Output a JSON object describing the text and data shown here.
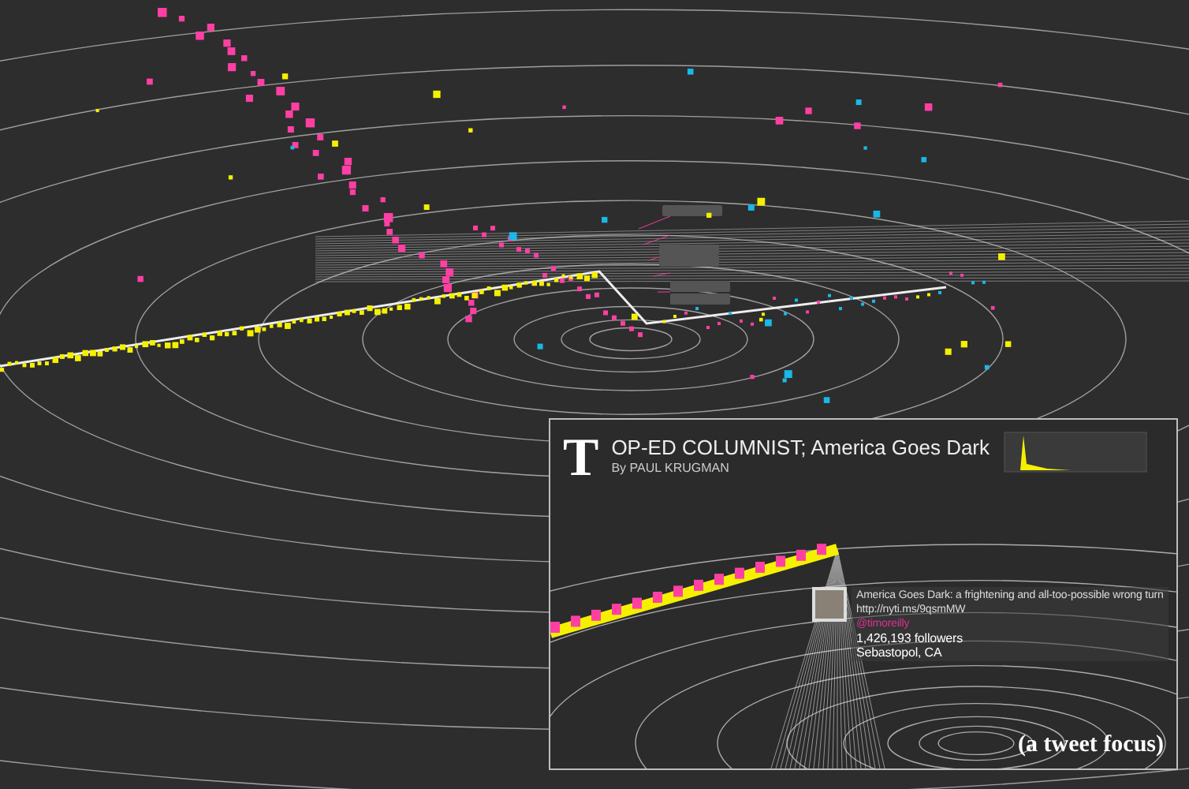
{
  "focus_panel": {
    "logo": "T",
    "headline": "OP-ED COLUMNIST; America Goes Dark",
    "byline": "By PAUL KRUGMAN",
    "tweet": {
      "text": "America Goes Dark: a frightening and all-too-possible wrong turn",
      "link": "http://nyti.ms/9qsmMW",
      "handle": "@timoreilly",
      "followers": "1,426,193 followers",
      "location": "Sebastopol, CA"
    }
  },
  "caption": "(a tweet focus)"
}
